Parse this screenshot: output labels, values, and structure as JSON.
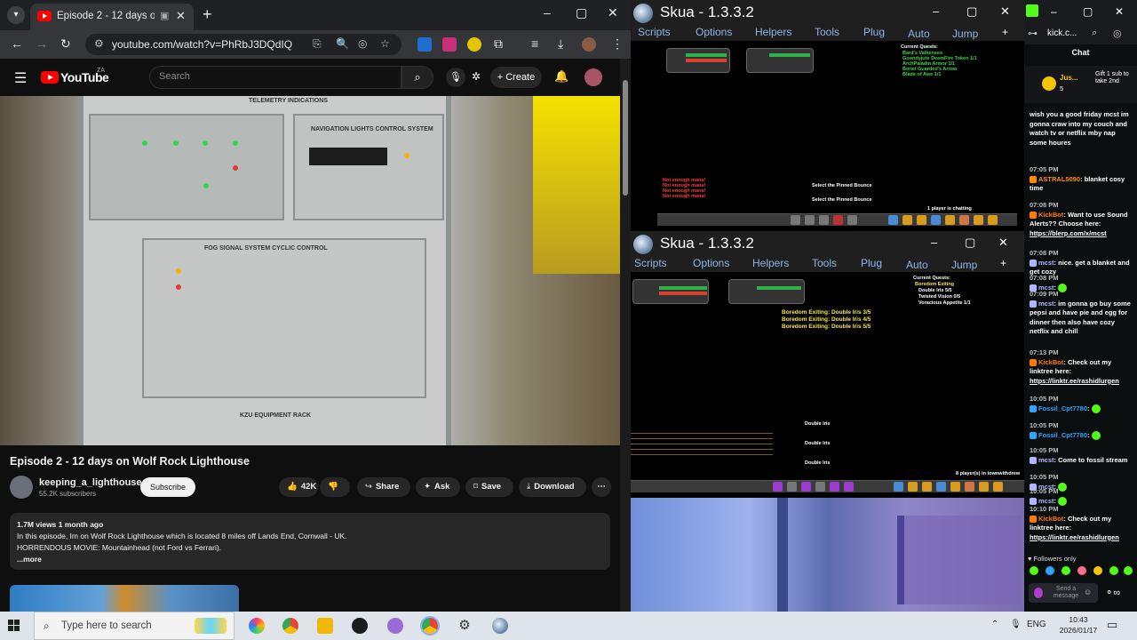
{
  "chrome": {
    "tab_title": "Episode 2 - 12 days on Wolf Rock Lighthouse",
    "url": "youtube.com/watch?v=PhRbJ3DQdIQ",
    "new_tab": "+",
    "minimize": "–",
    "maximize": "▢",
    "close": "✕"
  },
  "youtube": {
    "logo_text": "YouTube",
    "country": "ZA",
    "search_placeholder": "Search",
    "create_label": "Create",
    "video_title": "Episode 2 - 12 days on Wolf Rock Lighthouse",
    "channel_name": "keeping_a_lighthouse",
    "subscribers": "55.2K subscribers",
    "subscribe_label": "Subscribe",
    "likes": "42K",
    "share_label": "Share",
    "ask_label": "Ask",
    "save_label": "Save",
    "download_label": "Download",
    "desc_stats": "1.7M views  1 month ago",
    "desc_line1": "In this episode, Im on Wolf Rock Lighthouse which is located 8 miles off Lands End, Cornwall - UK.",
    "desc_line2": "HORRENDOUS MOVIE: Mountainhead (not Ford vs Ferrari).",
    "desc_more": "...more",
    "video_labels": {
      "telemetry": "TELEMETRY INDICATIONS",
      "nav_lights": "NAVIGATION LIGHTS CONTROL SYSTEM",
      "fog_signal": "FOG SIGNAL SYSTEM CYCLIC CONTROL",
      "equipment": "KZU EQUIPMENT RACK"
    }
  },
  "skua": {
    "title": "Skua - 1.3.3.2",
    "menu": [
      "Scripts",
      "Options",
      "Helpers",
      "Tools",
      "Plug",
      "Auto",
      "Jump"
    ],
    "add": "+",
    "top": {
      "quest_header": "Current Quests:",
      "quests": [
        "Bard's Valkenses",
        "Goondyjute DeemFire Token 1/1",
        "ArchPaladin Armor 1/1",
        "Boriel Guarded's Arrow",
        "Blade of Awe 1/1"
      ],
      "warnings": [
        "Not enough mana!",
        "Not enough mana!",
        "Not enough mana!",
        "Not enough mana!"
      ],
      "players": "1 player is chatting",
      "drops": [
        "Select the Pinned Bounce",
        "Select the Pinned Bounce"
      ]
    },
    "bottom": {
      "quest_header": "Current Quests:",
      "quests": [
        "Boredom Exiting",
        "Double Iris 5/5",
        "Twisted Vision 0/5",
        "Voracious Appetite 1/1"
      ],
      "exiting": [
        "Boredom Exiting: Double Iris 3/5",
        "Boredom Exiting: Double Iris 4/5",
        "Boredom Exiting: Double Iris 5/5"
      ],
      "drops": [
        "Double Iris",
        "Double Iris",
        "Double Iris"
      ],
      "players": "8 player(s) in townwithdrew"
    }
  },
  "kick": {
    "tab_title": "kick.c...",
    "chat_title": "Chat",
    "pinned_user": "Jus...",
    "pinned_count": "5",
    "pinned_text": "Gift 1 sub to take 2nd",
    "messages": [
      {
        "time": "",
        "user": "",
        "color": "#ffffff",
        "text": "wish you a good friday mcst im gonna craw into my couch and watch tv or netflix mby nap some houres",
        "link": ""
      },
      {
        "time": "07:05 PM",
        "user": "ASTRAL5090",
        "color": "#ff8a00",
        "text": "blanket cosy time",
        "link": ""
      },
      {
        "time": "07:08 PM",
        "user": "KickBot",
        "color": "#ff7a00",
        "text": "Want to use Sound Alerts?? Choose here:",
        "link": "https://blerp.com/x/mcst"
      },
      {
        "time": "07:08 PM",
        "user": "mcst",
        "color": "#b1b4ff",
        "text": "nice. get a blanket and get cozy",
        "link": ""
      },
      {
        "time": "07:08 PM",
        "user": "mcst",
        "color": "#b1b4ff",
        "text": "",
        "link": ""
      },
      {
        "time": "07:09 PM",
        "user": "mcst",
        "color": "#b1b4ff",
        "text": "im gonna go buy some pepsi and have pie and egg for dinner then also have cozy netflix and chill",
        "link": ""
      },
      {
        "time": "07:13 PM",
        "user": "KickBot",
        "color": "#ff7a00",
        "text": "Check out my linktree here:",
        "link": "https://linktr.ee/rashidlurgen"
      },
      {
        "time": "10:05 PM",
        "user": "Fossil_Cpt7780",
        "color": "#2fa4ff",
        "text": "",
        "link": ""
      },
      {
        "time": "10:05 PM",
        "user": "Fossil_Cpt7780",
        "color": "#2fa4ff",
        "text": "",
        "link": ""
      },
      {
        "time": "10:05 PM",
        "user": "mcst",
        "color": "#b1b4ff",
        "text": "Come to fossil stream",
        "link": ""
      },
      {
        "time": "10:05 PM",
        "user": "mcst",
        "color": "#b1b4ff",
        "text": "",
        "link": ""
      },
      {
        "time": "10:05 PM",
        "user": "mcst",
        "color": "#b1b4ff",
        "text": "",
        "link": ""
      },
      {
        "time": "10:10 PM",
        "user": "KickBot",
        "color": "#ff7a00",
        "text": "Check out my linktree here:",
        "link": "https://linktr.ee/rashidlurgen"
      }
    ],
    "followers_only": "Followers only",
    "send_placeholder": "Send a message"
  },
  "taskbar": {
    "search_placeholder": "Type here to search",
    "lang": "ENG",
    "time": "10:43",
    "date": "2026/01/17"
  }
}
